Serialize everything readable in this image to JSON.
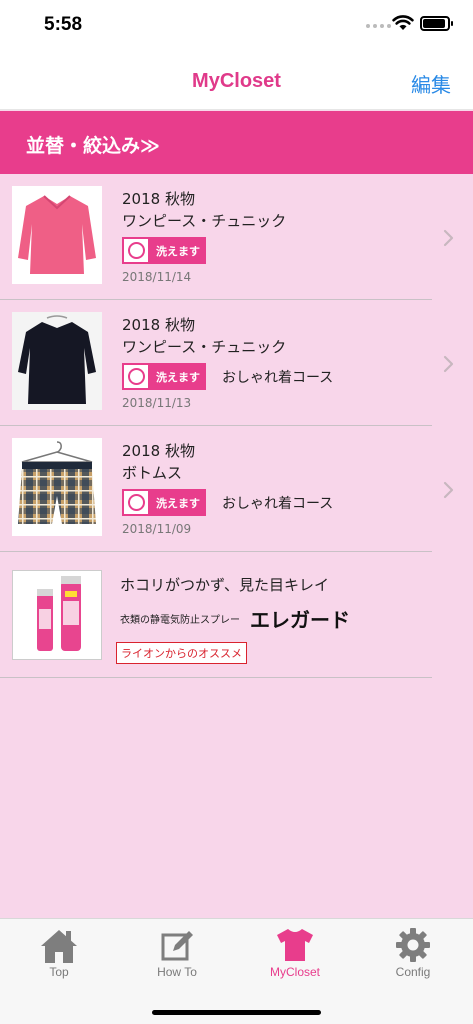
{
  "status_bar": {
    "time": "5:58"
  },
  "nav": {
    "title": "MyCloset",
    "edit_label": "編集"
  },
  "filter": {
    "label": "並替・絞込み≫"
  },
  "items": [
    {
      "season": "2018 秋物",
      "category": "ワンピース・チュニック",
      "wash_label": "洗えます",
      "course": "",
      "date": "2018/11/14",
      "thumb_color": "#ef5f86"
    },
    {
      "season": "2018 秋物",
      "category": "ワンピース・チュニック",
      "wash_label": "洗えます",
      "course": "おしゃれ着コース",
      "date": "2018/11/13",
      "thumb_color": "#151724"
    },
    {
      "season": "2018 秋物",
      "category": "ボトムス",
      "wash_label": "洗えます",
      "course": "おしゃれ着コース",
      "date": "2018/11/09",
      "thumb_color": "#c7a068"
    }
  ],
  "ad": {
    "headline": "ホコリがつかず、見た目キレイ",
    "subtitle": "衣類の静電気防止スプレー",
    "brand": "エレガード",
    "tag": "ライオンからのオススメ"
  },
  "tabs": [
    {
      "label": "Top",
      "icon": "home-icon",
      "active": false
    },
    {
      "label": "How To",
      "icon": "edit-icon",
      "active": false
    },
    {
      "label": "MyCloset",
      "icon": "tshirt-icon",
      "active": true
    },
    {
      "label": "Config",
      "icon": "gear-icon",
      "active": false
    }
  ],
  "colors": {
    "accent": "#e83d8c",
    "title": "#e03a8a",
    "background": "#f8d6ea",
    "link": "#2a8ae6"
  }
}
